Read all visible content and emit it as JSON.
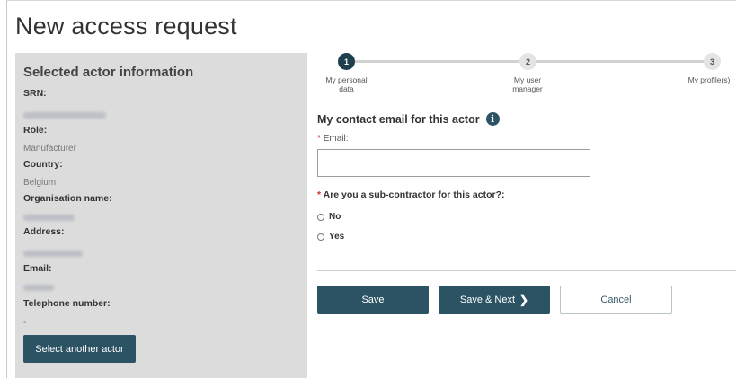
{
  "page": {
    "title": "New access request"
  },
  "sidebar": {
    "heading": "Selected actor information",
    "fields": [
      {
        "label": "SRN:",
        "value": "",
        "redacted": true
      },
      {
        "label": "Role:",
        "value": "Manufacturer",
        "redacted": false
      },
      {
        "label": "Country:",
        "value": "Belgium",
        "redacted": false
      },
      {
        "label": "Organisation name:",
        "value": "",
        "redacted": true
      },
      {
        "label": "Address:",
        "value": "",
        "redacted": true
      },
      {
        "label": "Email:",
        "value": "",
        "redacted": true
      },
      {
        "label": "Telephone number:",
        "value": "-",
        "redacted": false
      }
    ],
    "select_button": "Select another actor"
  },
  "stepper": {
    "steps": [
      {
        "number": "1",
        "label_line1": "My personal",
        "label_line2": "data",
        "active": true
      },
      {
        "number": "2",
        "label_line1": "My user",
        "label_line2": "manager",
        "active": false
      },
      {
        "number": "3",
        "label_line1": "My profile(s)",
        "label_line2": "",
        "active": false
      }
    ]
  },
  "form": {
    "section_title": "My contact email for this actor",
    "info_icon": "info-icon",
    "required_marker": "*",
    "email_label": "Email:",
    "email_value": "",
    "subcontractor_question": "Are you a sub-contractor for this actor?:",
    "options": [
      "No",
      "Yes"
    ]
  },
  "buttons": {
    "save": "Save",
    "save_next": "Save & Next",
    "cancel": "Cancel"
  },
  "colors": {
    "primary": "#2b5363",
    "step_active": "#1f3f4f",
    "sidebar_bg": "#dcdcdc",
    "required": "#c0392b"
  }
}
